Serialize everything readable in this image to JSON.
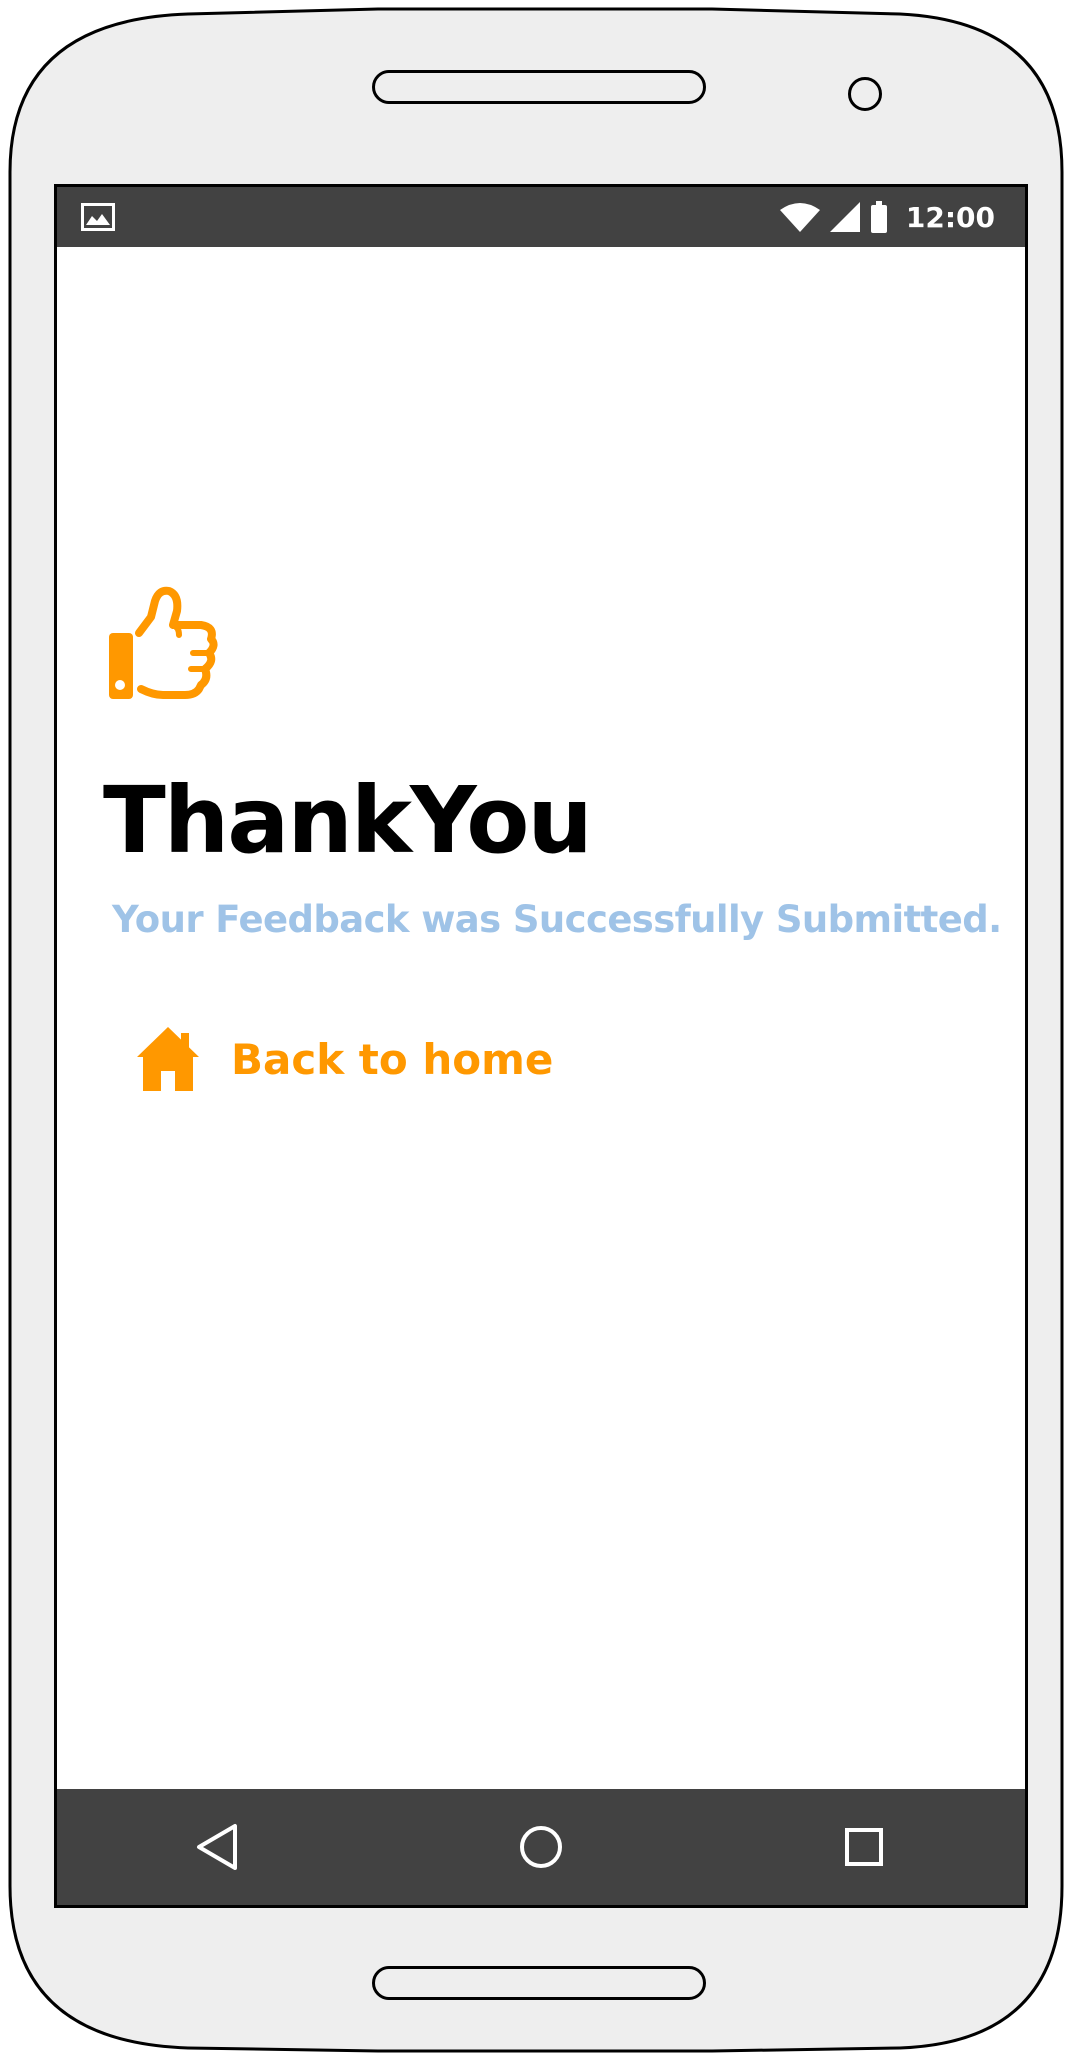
{
  "status_bar": {
    "time": "12:00",
    "icons": [
      "image-icon",
      "wifi-icon",
      "signal-icon",
      "battery-icon"
    ]
  },
  "main": {
    "title": "ThankYou",
    "subtitle": "Your Feedback was Successfully Submitted.",
    "feedback_icon": "thumbs-up-icon",
    "home_link": {
      "label": "Back to home",
      "icon": "home-icon"
    }
  },
  "nav_bar": {
    "icons": [
      "back-icon",
      "home-circle-icon",
      "recents-icon"
    ]
  },
  "colors": {
    "accent": "#ff9800",
    "subtitle": "#9fc3e7",
    "bar": "#424242",
    "device_body": "#eeeeee"
  }
}
